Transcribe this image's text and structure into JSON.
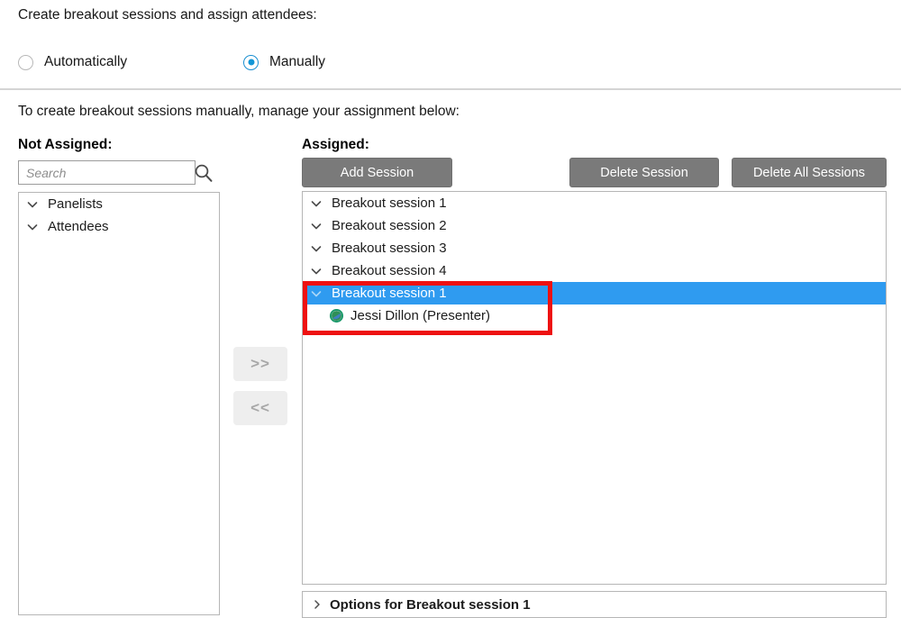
{
  "intro": {
    "prompt": "Create breakout sessions and assign attendees:"
  },
  "mode_options": [
    {
      "label": "Automatically",
      "selected": false,
      "name": "radio-automatically"
    },
    {
      "label": "Manually",
      "selected": true,
      "name": "radio-manually"
    }
  ],
  "instruction": "To create breakout sessions manually, manage your assignment below:",
  "not_assigned": {
    "heading": "Not Assigned:",
    "search": {
      "placeholder": "Search",
      "value": "",
      "icon": "search-icon"
    },
    "items": [
      {
        "label": "Panelists",
        "icon": "chevron-down-icon"
      },
      {
        "label": "Attendees",
        "icon": "chevron-down-icon"
      }
    ]
  },
  "transfer": {
    "assign_label": ">>",
    "unassign_label": "<<"
  },
  "assigned": {
    "heading": "Assigned:",
    "buttons": {
      "add": "Add Session",
      "delete": "Delete Session",
      "delete_all": "Delete All Sessions"
    },
    "items": [
      {
        "label": "Breakout session 1",
        "icon": "chevron-down-icon",
        "selected": false,
        "type": "session"
      },
      {
        "label": "Breakout session 2",
        "icon": "chevron-down-icon",
        "selected": false,
        "type": "session"
      },
      {
        "label": "Breakout session 3",
        "icon": "chevron-down-icon",
        "selected": false,
        "type": "session"
      },
      {
        "label": "Breakout session 4",
        "icon": "chevron-down-icon",
        "selected": false,
        "type": "session"
      },
      {
        "label": "Breakout session 1",
        "icon": "chevron-down-icon",
        "selected": true,
        "type": "session"
      },
      {
        "label": "Jessi Dillon (Presenter)",
        "icon": "presenter-icon",
        "selected": false,
        "type": "attendee"
      }
    ]
  },
  "options_bar": {
    "label": "Options for Breakout session 1",
    "icon": "chevron-right-icon"
  },
  "colors": {
    "selection_blue": "#2f9bf0",
    "radio_accent": "#1296d6",
    "button_gray": "#7a7a7a",
    "annotation_red": "#ee1111",
    "presenter_green": "#1f9d6a"
  }
}
